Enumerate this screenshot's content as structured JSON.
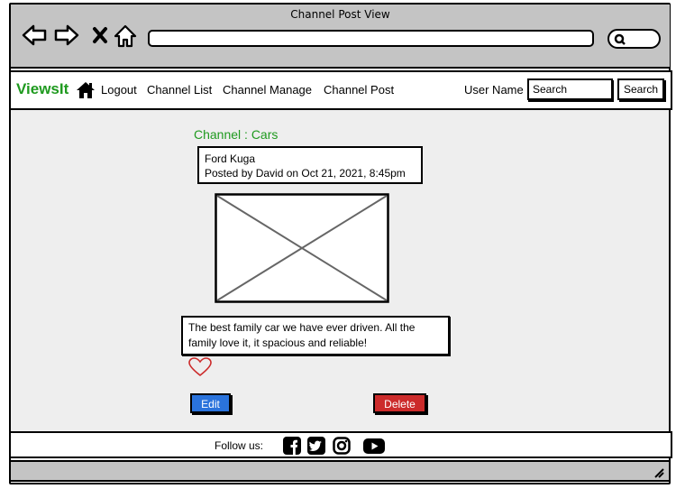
{
  "window": {
    "title": "Channel Post View"
  },
  "browser": {
    "icons": [
      "back-arrow-icon",
      "forward-arrow-icon",
      "close-x-icon",
      "home-outline-icon"
    ],
    "url": "",
    "search_icon": "search-icon"
  },
  "nav": {
    "brand": "ViewsIt",
    "home_icon": "home-icon",
    "links": [
      "Logout",
      "Channel List",
      "Channel Manage",
      "Channel Post"
    ],
    "user_label": "User Name",
    "search_placeholder": "Search",
    "search_button": "Search"
  },
  "post": {
    "channel_heading": "Channel : Cars",
    "title": "Ford Kuga",
    "meta": "Posted by David on Oct 21, 2021, 8:45pm",
    "body": "The best family car we have ever driven. All the family love it, it spacious and reliable!",
    "like_icon": "heart-icon",
    "edit_label": "Edit",
    "delete_label": "Delete"
  },
  "footer": {
    "follow_label": "Follow us:",
    "social_icons": [
      "facebook-icon",
      "twitter-icon",
      "instagram-icon",
      "youtube-icon"
    ]
  },
  "colors": {
    "brand_green": "#1f9a1f",
    "edit_blue": "#2a73dc",
    "delete_red": "#cc2b2b",
    "chrome_gray": "#c4c4c4",
    "content_bg": "#eeeeee"
  }
}
